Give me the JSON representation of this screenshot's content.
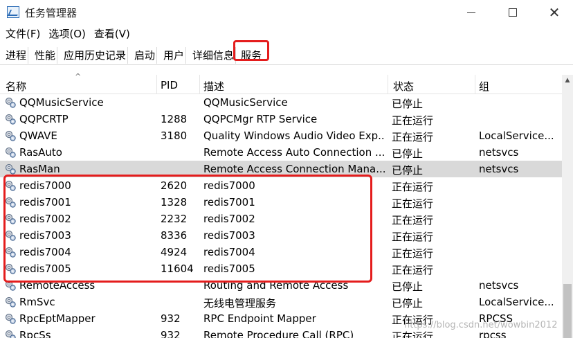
{
  "window": {
    "title": "任务管理器",
    "close_glyph": "✕"
  },
  "menu": [
    "文件(F)",
    "选项(O)",
    "查看(V)"
  ],
  "tabs": [
    "进程",
    "性能",
    "应用历史记录",
    "启动",
    "用户",
    "详细信息",
    "服务"
  ],
  "active_tab": "服务",
  "columns": {
    "name": "名称",
    "pid": "PID",
    "desc": "描述",
    "status": "状态",
    "group": "组"
  },
  "rows": [
    {
      "name": "QQMusicService",
      "pid": "",
      "desc": "QQMusicService",
      "status": "已停止",
      "group": ""
    },
    {
      "name": "QQPCRTP",
      "pid": "1288",
      "desc": "QQPCMgr RTP Service",
      "status": "正在运行",
      "group": ""
    },
    {
      "name": "QWAVE",
      "pid": "3180",
      "desc": "Quality Windows Audio Video Exp...",
      "status": "正在运行",
      "group": "LocalService..."
    },
    {
      "name": "RasAuto",
      "pid": "",
      "desc": "Remote Access Auto Connection ...",
      "status": "已停止",
      "group": "netsvcs"
    },
    {
      "name": "RasMan",
      "pid": "",
      "desc": "Remote Access Connection Mana...",
      "status": "已停止",
      "group": "netsvcs",
      "selected": true
    },
    {
      "name": "redis7000",
      "pid": "2620",
      "desc": "redis7000",
      "status": "正在运行",
      "group": ""
    },
    {
      "name": "redis7001",
      "pid": "1328",
      "desc": "redis7001",
      "status": "正在运行",
      "group": ""
    },
    {
      "name": "redis7002",
      "pid": "2232",
      "desc": "redis7002",
      "status": "正在运行",
      "group": ""
    },
    {
      "name": "redis7003",
      "pid": "8336",
      "desc": "redis7003",
      "status": "正在运行",
      "group": ""
    },
    {
      "name": "redis7004",
      "pid": "4924",
      "desc": "redis7004",
      "status": "正在运行",
      "group": ""
    },
    {
      "name": "redis7005",
      "pid": "11604",
      "desc": "redis7005",
      "status": "正在运行",
      "group": ""
    },
    {
      "name": "RemoteAccess",
      "pid": "",
      "desc": "Routing and Remote Access",
      "status": "已停止",
      "group": "netsvcs"
    },
    {
      "name": "RmSvc",
      "pid": "",
      "desc": "无线电管理服务",
      "status": "已停止",
      "group": "LocalService..."
    },
    {
      "name": "RpcEptMapper",
      "pid": "932",
      "desc": "RPC Endpoint Mapper",
      "status": "正在运行",
      "group": "RPCSS"
    },
    {
      "name": "RpcSs",
      "pid": "932",
      "desc": "Remote Procedure Call (RPC)",
      "status": "正在运行",
      "group": "rpcss"
    }
  ],
  "watermark": "https://blog.csdn.net/wowbin2012",
  "colors": {
    "highlight": "#e41c1c",
    "selected_row": "#d9d9d9"
  },
  "icons": {
    "app": "task-manager-icon",
    "service": "gear-service-icon"
  }
}
